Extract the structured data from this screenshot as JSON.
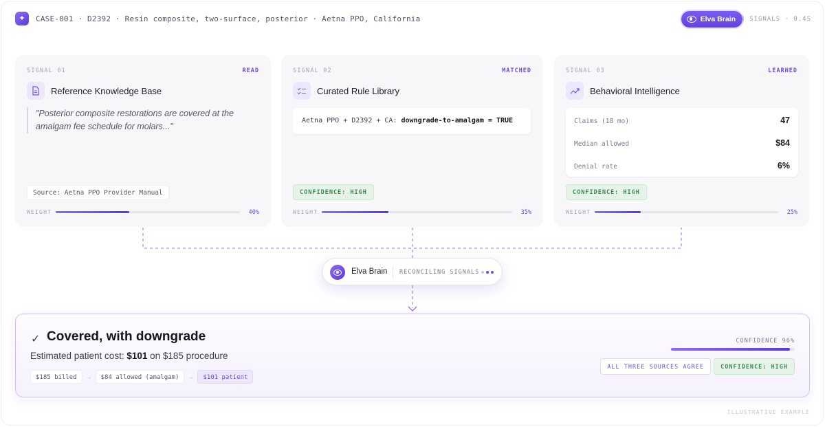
{
  "header": {
    "logo_glyph": "✦",
    "case_line": "CASE-001 · D2392 · Resin composite, two-surface, posterior · Aetna PPO, California",
    "brain_label": "Elva Brain",
    "meta": "3 SIGNALS · 0.4S"
  },
  "signals": [
    {
      "num": "SIGNAL 01",
      "status": "READ",
      "icon": "document-icon",
      "title": "Reference Knowledge Base",
      "quote": "\"Posterior composite restorations are covered at the amalgam fee schedule for molars...\"",
      "source": "Source: Aetna PPO Provider Manual",
      "weight_label": "WEIGHT",
      "weight": 0.4,
      "weight_text": "40%"
    },
    {
      "num": "SIGNAL 02",
      "status": "MATCHED",
      "icon": "checklist-icon",
      "title": "Curated Rule Library",
      "rule_prefix": "Aetna PPO + D2392 + CA: ",
      "rule_bold": "downgrade-to-amalgam = TRUE",
      "confidence": "CONFIDENCE: HIGH",
      "weight_label": "WEIGHT",
      "weight": 0.35,
      "weight_text": "35%"
    },
    {
      "num": "SIGNAL 03",
      "status": "LEARNED",
      "icon": "trend-up-icon",
      "title": "Behavioral Intelligence",
      "stats": [
        {
          "label": "Claims (18 mo)",
          "value": "47"
        },
        {
          "label": "Median allowed",
          "value": "$84"
        },
        {
          "label": "Denial rate",
          "value": "6%"
        }
      ],
      "confidence": "CONFIDENCE: HIGH",
      "weight_label": "WEIGHT",
      "weight": 0.25,
      "weight_text": "25%"
    }
  ],
  "node": {
    "title": "Elva Brain",
    "status": "RECONCILING SIGNALS"
  },
  "result": {
    "title": "Covered, with downgrade",
    "cost_prefix": "Estimated patient cost: ",
    "cost_value": "$101",
    "cost_suffix": " on $185 procedure",
    "chips": [
      "$185 billed",
      "$84 allowed (amalgam)",
      "$101 patient"
    ],
    "chip_arrow": "→",
    "confidence_label": "CONFIDENCE 96%",
    "confidence": 0.96,
    "agree": "ALL THREE SOURCES AGREE",
    "confidence_chip": "CONFIDENCE: HIGH"
  },
  "footnote": "ILLUSTRATIVE EXAMPLE",
  "colors": {
    "accent": "#6a4de0",
    "success": "#3f8a53",
    "connector": "#8b73e8"
  }
}
